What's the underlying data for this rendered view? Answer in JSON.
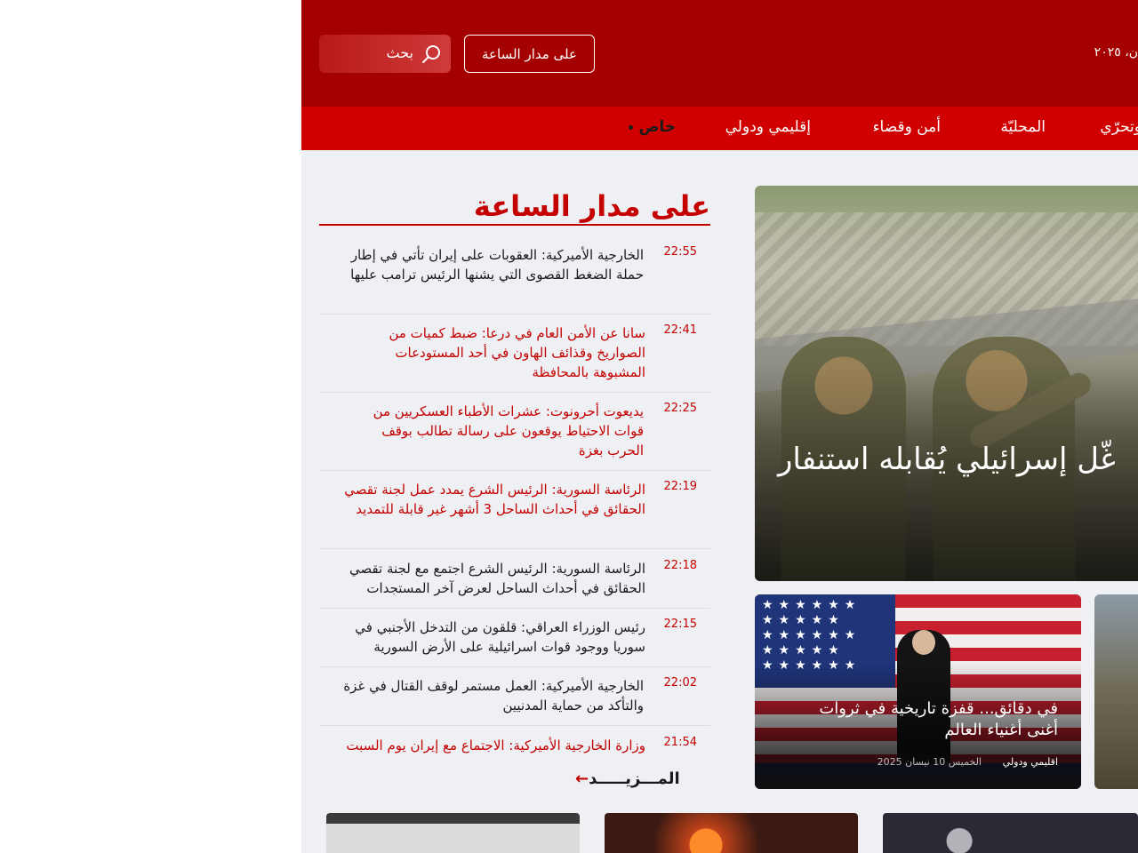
{
  "header": {
    "search_label": "بحث",
    "around_clock_button": "على مدار الساعة",
    "date_fragment": "ن، ٢٠٢٥"
  },
  "nav": {
    "items": [
      {
        "label": "وتحرّي"
      },
      {
        "label": "المحليّة"
      },
      {
        "label": "أمن وقضاء"
      },
      {
        "label": "إقليمي ودولي"
      },
      {
        "label": "خاص"
      }
    ]
  },
  "around_clock": {
    "title": "على مدار الساعة",
    "more_label": "المـــزيـــــد",
    "items": [
      {
        "time": "22:55",
        "headline": "الخارجية الأميركية: العقوبات على إيران تأتي في إطار حملة الضغط القصوى التي يشنها الرئيس ترامب عليها",
        "highlight": false
      },
      {
        "time": "22:41",
        "headline": "سانا عن الأمن العام في درعا: ضبط كميات من الصواريخ وقذائف الهاون في أحد المستودعات المشبوهة بالمحافظة",
        "highlight": true
      },
      {
        "time": "22:25",
        "headline": "يديعوت أحرونوت: عشرات الأطباء العسكريين من قوات الاحتياط يوقعون على رسالة تطالب بوقف الحرب بغزة",
        "highlight": true
      },
      {
        "time": "22:19",
        "headline": "الرئاسة السورية: الرئيس الشرع يمدد عمل لجنة تقصي الحقائق في أحداث الساحل 3 أشهر غير قابلة للتمديد",
        "highlight": true
      },
      {
        "time": "22:18",
        "headline": "الرئاسة السورية: الرئيس الشرع اجتمع مع لجنة تقصي الحقائق في أحداث الساحل لعرض آخر المستجدات",
        "highlight": false
      },
      {
        "time": "22:15",
        "headline": "رئيس الوزراء العراقي: قلقون من التدخل الأجنبي في سوريا ووجود قوات اسرائيلية على الأرض السورية",
        "highlight": false
      },
      {
        "time": "22:02",
        "headline": "الخارجية الأميركية: العمل مستمر لوقف القتال في غزة والتأكد من حماية المدنيين",
        "highlight": false
      },
      {
        "time": "21:54",
        "headline": "وزارة الخارجية الأميركية: الاجتماع مع إيران يوم السبت",
        "highlight": true
      }
    ]
  },
  "hero": {
    "title": "غّل إسرائيلي يُقابله استنفار"
  },
  "card": {
    "title": "في دقائق... قفزة تاريخية في ثروات أغنى أغنياء العالم",
    "category": "اقليمي ودولي",
    "date": "الخميس 10 نيسان 2025"
  },
  "colors": {
    "header_bg": "#a50000",
    "nav_bg": "#d10000",
    "accent": "#c40000",
    "page_bg": "#eef0f4"
  },
  "icons": {
    "search": "search-icon",
    "more_arrow": "arrow-left-icon"
  }
}
